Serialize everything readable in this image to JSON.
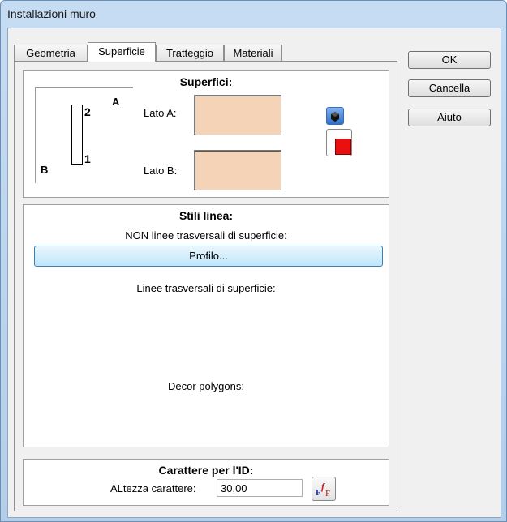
{
  "window": {
    "title": "Installazioni muro"
  },
  "tabs": [
    {
      "label": "Geometria"
    },
    {
      "label": "Superficie"
    },
    {
      "label": "Tratteggio"
    },
    {
      "label": "Materiali"
    }
  ],
  "side_buttons": {
    "ok": "OK",
    "cancel": "Cancella",
    "help": "Aiuto"
  },
  "surfaces": {
    "heading": "Superfici:",
    "diagram": {
      "mark_2": "2",
      "mark_a": "A",
      "mark_b": "B",
      "mark_1": "1"
    },
    "side_a_label": "Lato A:",
    "side_b_label": "Lato B:",
    "side_a_color": "#f5d3b6",
    "side_b_color": "#f5d3b6"
  },
  "line_styles": {
    "heading": "Stili linea:",
    "non_transversal_label": "NON linee trasversali di superficie:",
    "profile_button": "Profilo...",
    "transversal_label": "Linee trasversali di superficie:",
    "decor_label": "Decor polygons:"
  },
  "id_font": {
    "heading": "Carattere per l'ID:",
    "height_label": "ALtezza carattere:",
    "height_value": "30,00"
  }
}
